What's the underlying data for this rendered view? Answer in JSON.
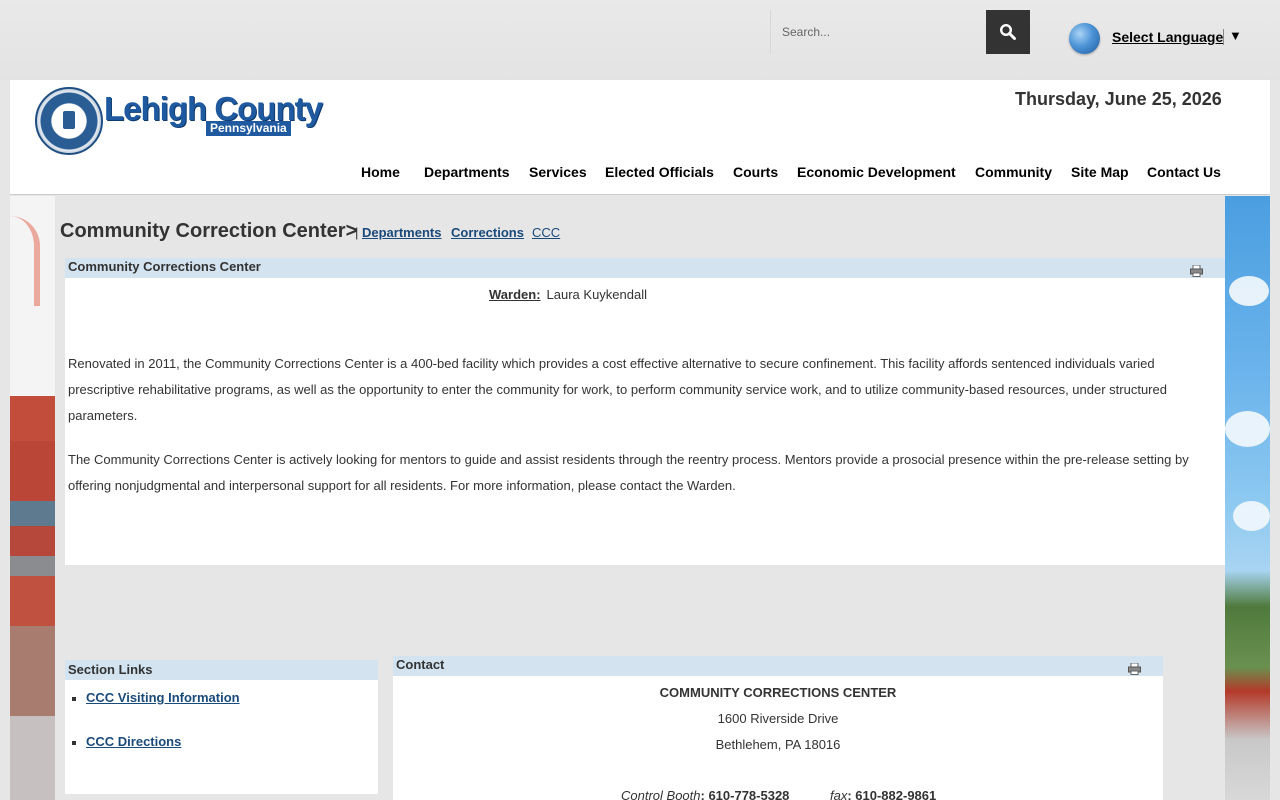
{
  "search": {
    "placeholder": "Search..."
  },
  "language": {
    "label": "Select Language",
    "arrow": "▼"
  },
  "header": {
    "logo_title": "Lehigh County",
    "logo_subtitle": "Pennsylvania",
    "date": "Thursday, June 25, 2026"
  },
  "nav": {
    "items": [
      {
        "label": "Home"
      },
      {
        "label": "Departments"
      },
      {
        "label": "Services"
      },
      {
        "label": "Elected Officials"
      },
      {
        "label": "Courts"
      },
      {
        "label": "Economic Development"
      },
      {
        "label": "Community"
      },
      {
        "label": "Site Map"
      },
      {
        "label": "Contact Us"
      }
    ]
  },
  "breadcrumb": {
    "title": "Community Correction Center>",
    "separator": "|",
    "links": [
      "Departments",
      "Corrections",
      "CCC"
    ]
  },
  "main_panel": {
    "heading": "Community Corrections Center",
    "warden_label": "Warden:",
    "warden_name": "Laura Kuykendall",
    "paragraph1": "Renovated in 2011, the Community Corrections Center is a 400-bed facility which provides a cost effective alternative to secure confinement.  This facility affords sentenced individuals varied prescriptive rehabilitative programs, as well as the opportunity to enter the community for work, to perform community service work, and to utilize community-based resources, under structured parameters.",
    "paragraph2": "The Community Corrections Center is actively looking for mentors to guide and assist residents through the reentry process.  Mentors provide a prosocial presence within the pre-release setting by offering nonjudgmental and interpersonal support for all residents.  For more information, please contact the Warden."
  },
  "section_links": {
    "heading": "Section Links",
    "items": [
      "CCC Visiting Information",
      "CCC Directions"
    ]
  },
  "contact": {
    "heading": "Contact",
    "name": "COMMUNITY CORRECTIONS CENTER",
    "address1": "1600 Riverside Drive",
    "address2": "Bethlehem, PA 18016",
    "phone_label": "Control Booth",
    "phone": ": 610-778-5328",
    "fax_label": "fax",
    "fax": ": 610-882-9861"
  }
}
